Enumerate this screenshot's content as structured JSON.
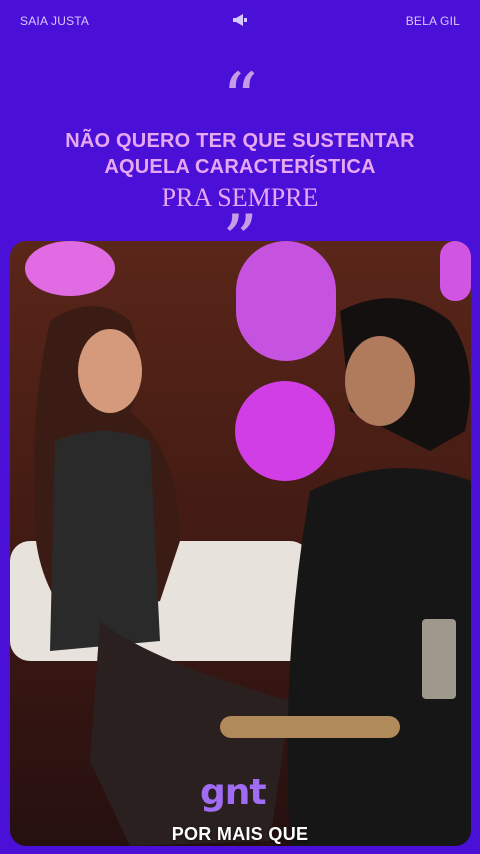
{
  "header": {
    "left_label": "SAIA JUSTA",
    "right_label": "BELA GIL",
    "center_icon": "megaphone-icon"
  },
  "quote": {
    "open_mark": "“",
    "line1": "NÃO QUERO TER QUE SUSTENTAR",
    "line2": "AQUELA CARACTERÍSTICA",
    "line3": "PRA SEMPRE",
    "close_mark": "”"
  },
  "video": {
    "caption": "POR MAIS QUE",
    "logo": "gnt"
  },
  "colors": {
    "background": "#4a10d8",
    "quote_text": "#e6a8f2",
    "quote_marks": "#c79be8",
    "logo": "#9f6cf3"
  }
}
